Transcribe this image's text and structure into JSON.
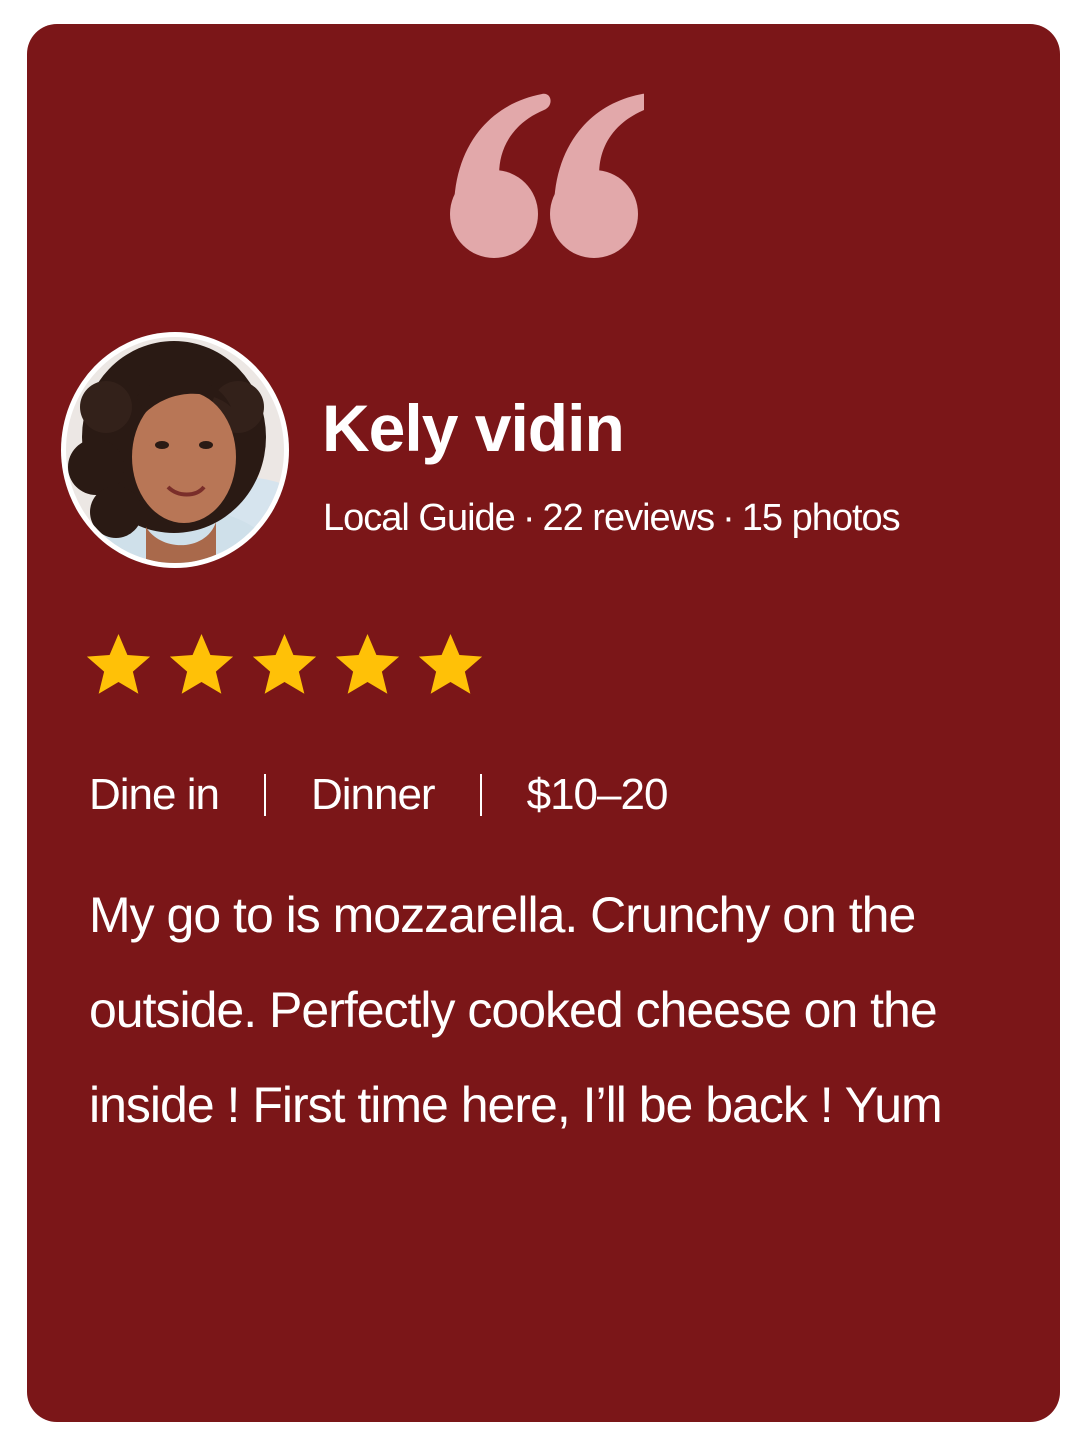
{
  "colors": {
    "card_background": "#7b1618",
    "text": "#ffffff",
    "quote_mark": "#e2a8aa",
    "star": "#ffc107"
  },
  "reviewer": {
    "name": "Kely vidin",
    "role": "Local Guide",
    "review_count": "22 reviews",
    "photo_count": "15 photos",
    "separator": "·",
    "avatar_icon": "person-avatar"
  },
  "rating": {
    "stars": 5,
    "max": 5,
    "icon": "star-icon"
  },
  "tags": {
    "service": "Dine in",
    "meal": "Dinner",
    "price": "$10–20"
  },
  "review": {
    "text": "My go to is mozzarella. Crunchy on the outside. Perfectly cooked cheese on the inside ! First time here, I’ll be back ! Yum"
  },
  "decor": {
    "quote_icon": "quote-icon"
  }
}
